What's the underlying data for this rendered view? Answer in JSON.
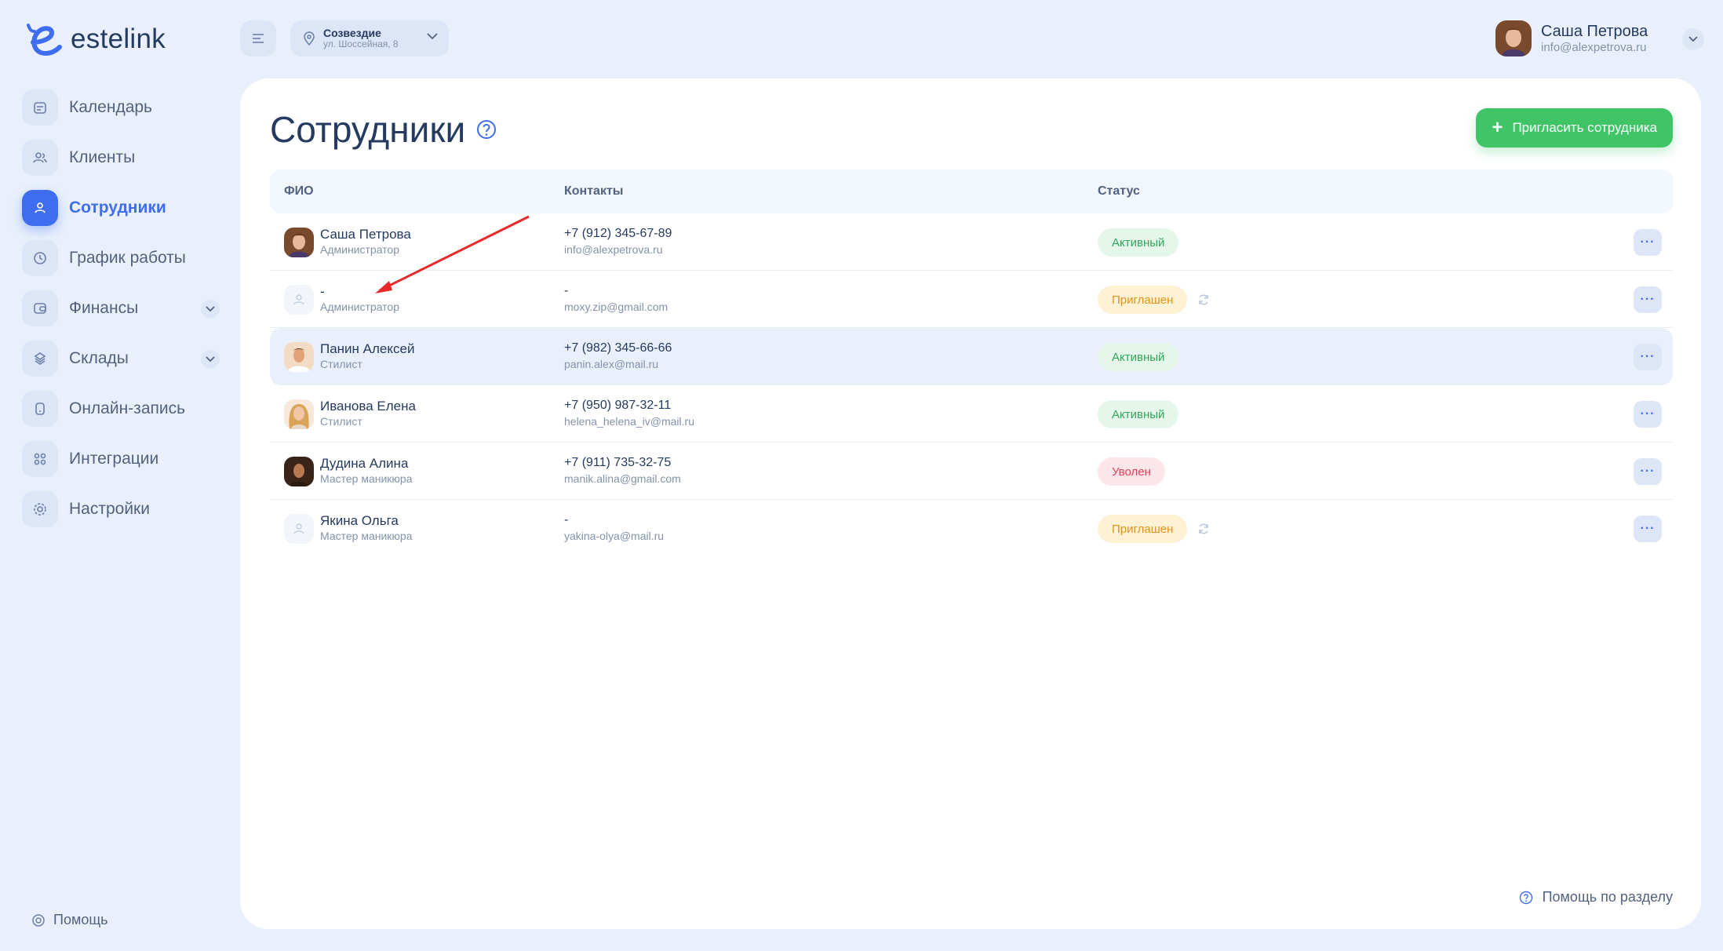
{
  "app": {
    "logo_text": "estelink"
  },
  "sidebar": {
    "items": [
      {
        "label": "Календарь",
        "icon": "calendar-icon"
      },
      {
        "label": "Клиенты",
        "icon": "users-icon"
      },
      {
        "label": "Сотрудники",
        "icon": "user-icon",
        "active": true
      },
      {
        "label": "График работы",
        "icon": "clock-icon"
      },
      {
        "label": "Финансы",
        "icon": "wallet-icon",
        "expandable": true
      },
      {
        "label": "Склады",
        "icon": "boxes-icon",
        "expandable": true
      },
      {
        "label": "Онлайн-запись",
        "icon": "phone-icon"
      },
      {
        "label": "Интеграции",
        "icon": "grid-icon"
      },
      {
        "label": "Настройки",
        "icon": "gear-icon"
      }
    ],
    "help_label": "Помощь"
  },
  "topbar": {
    "location_name": "Созвездие",
    "location_address": "ул. Шоссейная, 8",
    "user_name": "Саша Петрова",
    "user_email": "info@alexpetrova.ru"
  },
  "page": {
    "title": "Сотрудники",
    "invite_button": "Пригласить сотрудника",
    "section_help": "Помощь по разделу"
  },
  "table": {
    "headers": {
      "fio": "ФИО",
      "contacts": "Контакты",
      "status": "Статус"
    },
    "rows": [
      {
        "name": "Саша Петрова",
        "role": "Администратор",
        "phone": "+7 (912) 345-67-89",
        "email": "info@alexpetrova.ru",
        "status": "Активный",
        "status_type": "active"
      },
      {
        "name": "-",
        "role": "Администратор",
        "phone": "-",
        "email": "moxy.zip@gmail.com",
        "status": "Приглашен",
        "status_type": "invited"
      },
      {
        "name": "Панин Алексей",
        "role": "Стилист",
        "phone": "+7 (982) 345-66-66",
        "email": "panin.alex@mail.ru",
        "status": "Активный",
        "status_type": "active"
      },
      {
        "name": "Иванова Елена",
        "role": "Стилист",
        "phone": "+7 (950) 987-32-11",
        "email": "helena_helena_iv@mail.ru",
        "status": "Активный",
        "status_type": "active"
      },
      {
        "name": "Дудина Алина",
        "role": "Мастер маникюра",
        "phone": "+7 (911) 735-32-75",
        "email": "manik.alina@gmail.com",
        "status": "Уволен",
        "status_type": "fired"
      },
      {
        "name": "Якина Ольга",
        "role": "Мастер маникюра",
        "phone": "-",
        "email": "yakina-olya@mail.ru",
        "status": "Приглашен",
        "status_type": "invited"
      }
    ]
  },
  "colors": {
    "accent": "#3e6df0",
    "success": "#3fc466",
    "background": "#e9f0fb",
    "annotation_arrow": "#e8282b"
  }
}
